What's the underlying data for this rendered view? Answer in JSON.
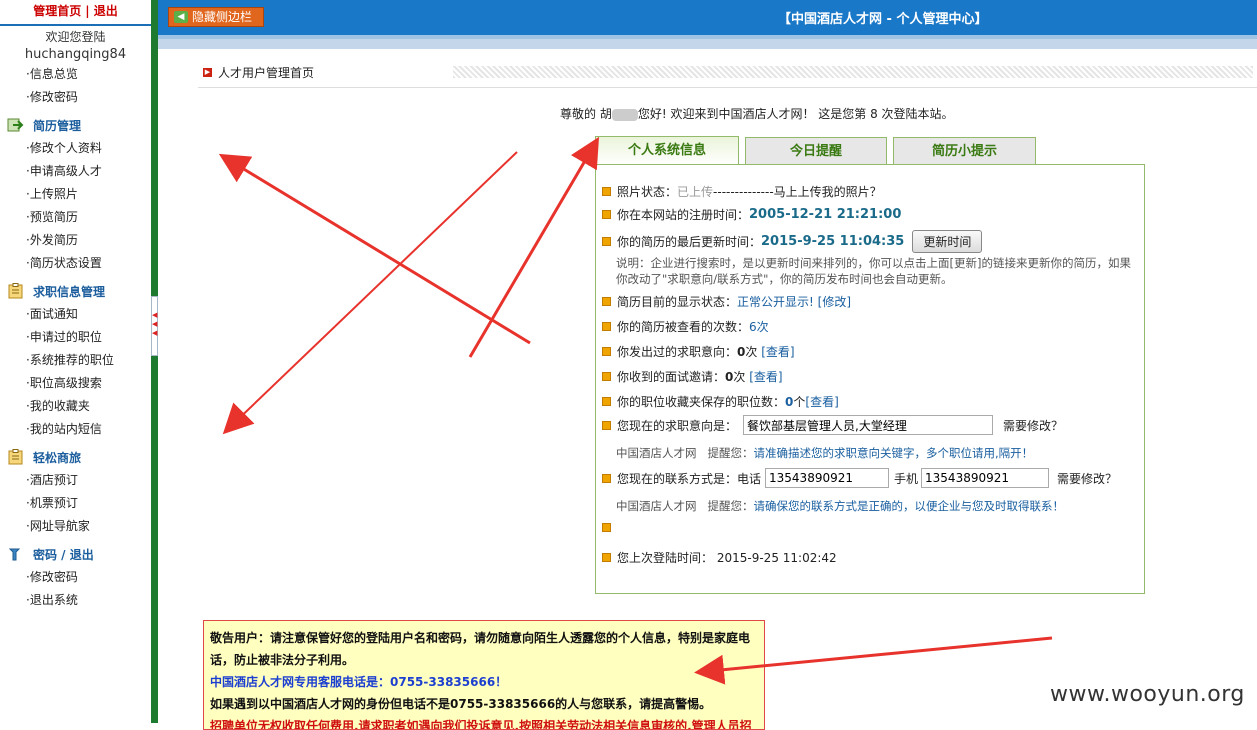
{
  "sidebar": {
    "top_links": [
      "管理首页",
      "退出"
    ],
    "welcome": "欢迎您登陆",
    "username": "huchangqing84",
    "account_items": [
      "·信息总览",
      "·修改密码"
    ],
    "sections": [
      {
        "title": "简历管理",
        "icon": "arrow-right-icon",
        "items": [
          "·修改个人资料",
          "·申请高级人才",
          "·上传照片",
          "·预览简历",
          "·外发简历",
          "·简历状态设置"
        ]
      },
      {
        "title": "求职信息管理",
        "icon": "clipboard-icon",
        "items": [
          "·面试通知",
          "·申请过的职位",
          "·系统推荐的职位",
          "·职位高级搜索",
          "·我的收藏夹",
          "·我的站内短信"
        ]
      },
      {
        "title": "轻松商旅",
        "icon": "clipboard-icon",
        "items": [
          "·酒店预订",
          "·机票预订",
          "·网址导航家"
        ]
      },
      {
        "title": "密码 / 退出",
        "icon": "wrench-icon",
        "items": [
          "·修改密码",
          "·退出系统"
        ]
      }
    ]
  },
  "header": {
    "hide_sidebar": "隐藏侧边栏",
    "title": "【中国酒店人才网 - 个人管理中心】"
  },
  "page": {
    "heading": "人才用户管理首页",
    "greeting_pre": "尊敬的 胡",
    "greeting_post": "您好! 欢迎来到中国酒店人才网！ 这是您第 8 次登陆本站。"
  },
  "tabs": [
    "个人系统信息",
    "今日提醒",
    "简历小提示"
  ],
  "info": {
    "photo_label": "照片状态：",
    "photo_status": "已上传",
    "photo_dashes": " -------------- ",
    "photo_link": "马上上传我的照片？",
    "reg_label": "你在本网站的注册时间：",
    "reg_time": "2005-12-21 21:21:00",
    "update_label": "你的简历的最后更新时间：",
    "update_time": "2015-9-25 11:04:35",
    "update_button": "更新时间",
    "note": "说明：企业进行搜索时，是以更新时间来排列的，你可以点击上面[更新]的链接来更新你的简历，如果你改动了\"求职意向/联系方式\"，你的简历发布时间也会自动更新。",
    "display_label": "简历目前的显示状态：",
    "display_status": "正常公开显示!",
    "modify_link": "[修改]",
    "viewed_label": "你的简历被查看的次数：",
    "viewed_count": "6次",
    "sent_label": "你发出过的求职意向：",
    "sent_count": "0",
    "sent_unit": "次",
    "view_link": "[查看]",
    "invite_label": "你收到的面试邀请：",
    "invite_count": "0",
    "invite_unit": "次",
    "fav_label": "你的职位收藏夹保存的职位数：",
    "fav_count": "0",
    "fav_unit": " 个 ",
    "intent_label": "您现在的求职意向是：",
    "intent_value": "餐饮部基层管理人员,大堂经理",
    "need_modify": "需要修改？",
    "hint_site": "中国酒店人才网",
    "hint_remind": "提醒您：",
    "hint_intent": "请准确描述您的求职意向关键字，多个职位请用,隔开！",
    "contact_label": "您现在的联系方式是：电话",
    "phone_value": "13543890921",
    "mobile_label": "手机",
    "mobile_value": "13543890921",
    "hint_contact": "请确保您的联系方式是正确的，以便企业与您及时取得联系！",
    "last_login_label": "您上次登陆时间：",
    "last_login_time": "2015-9-25 11:02:42"
  },
  "warning": {
    "line1": "敬告用户：请注意保管好您的登陆用户名和密码，请勿随意向陌生人透露您的个人信息，特别是家庭电",
    "line2": "话，防止被非法分子利用。",
    "line3": "中国酒店人才网专用客服电话是：0755-33835666！",
    "line4": "如果遇到以中国酒店人才网的身份但电话不是0755-33835666的人与您联系，请提高警惕。",
    "line5": "招聘单位无权收取任何费用,请求职者如遇向我们投诉意见,按照相关劳动法相关信息审核的,管理人员招聘"
  },
  "watermark": "www.wooyun.org",
  "colors": {
    "header_blue": "#1978c8",
    "sidebar_green": "#1e7a2e",
    "tab_green": "#3a7a12",
    "annotation_red": "#e8322c"
  }
}
